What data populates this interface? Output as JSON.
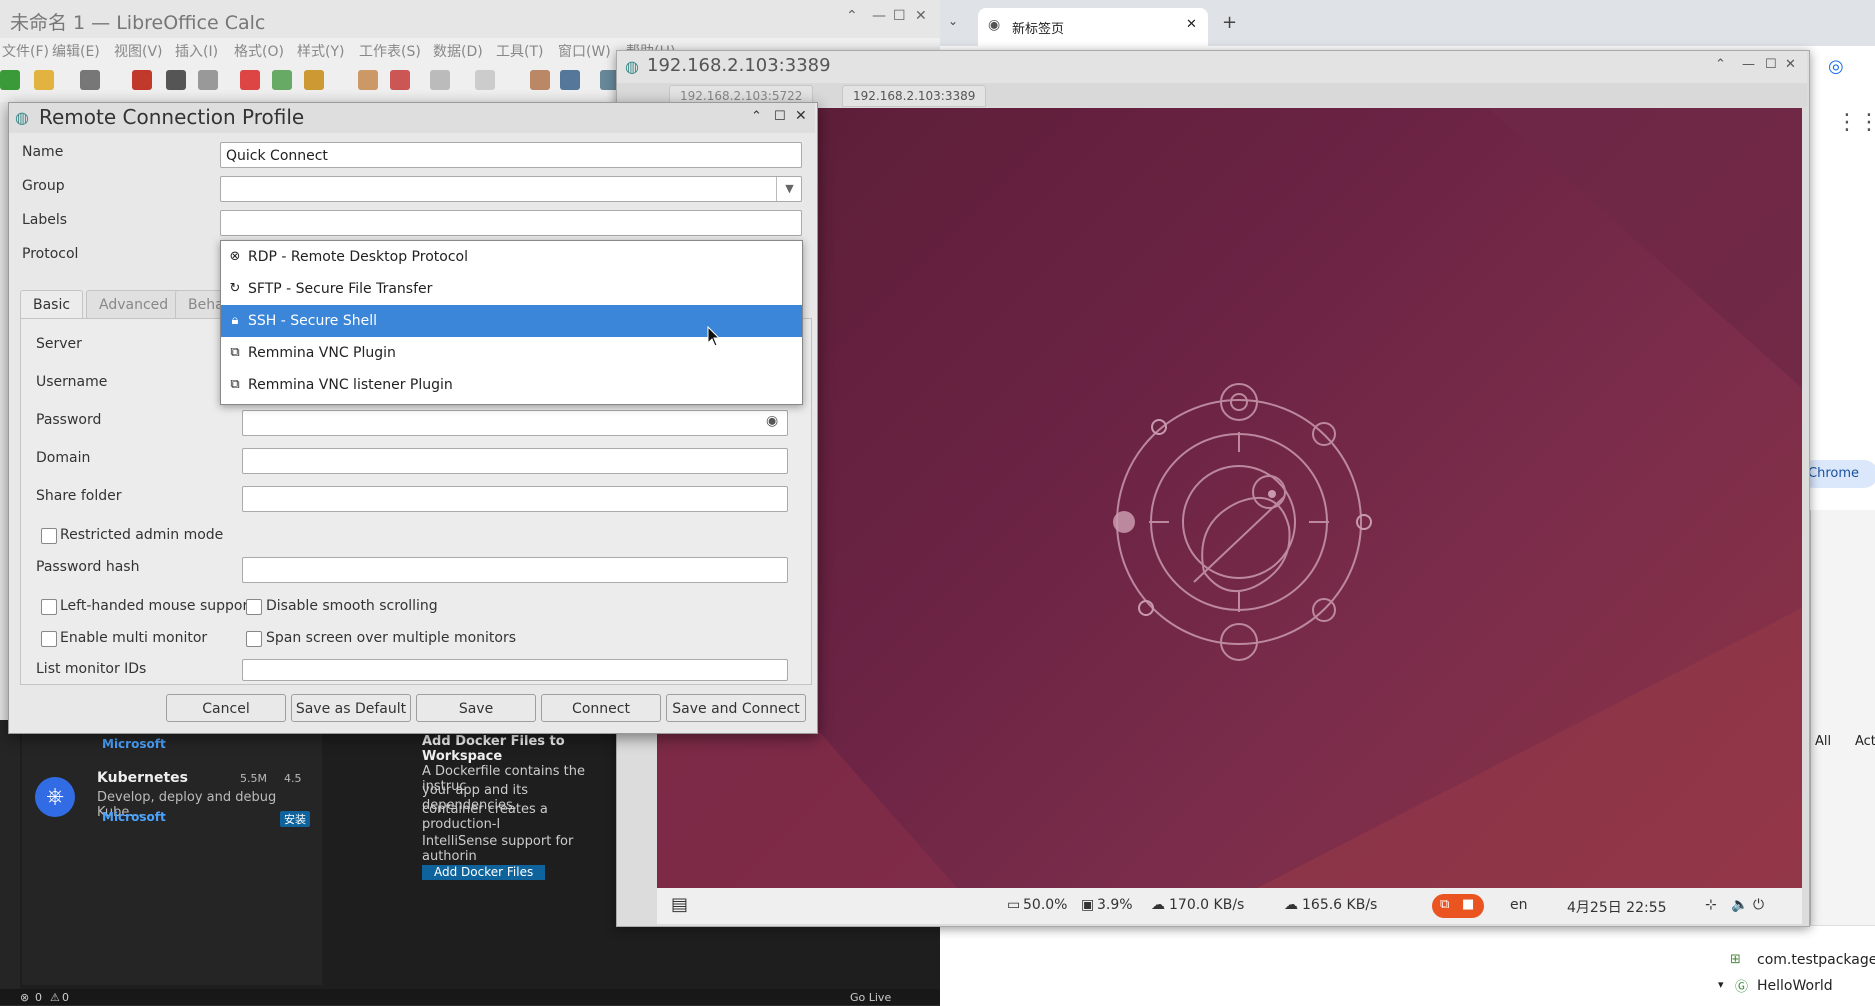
{
  "calc": {
    "title": "未命名 1 — LibreOffice Calc",
    "menu": [
      "文件(F)",
      "编辑(E)",
      "视图(V)",
      "插入(I)",
      "格式(O)",
      "样式(Y)",
      "工作表(S)",
      "数据(D)",
      "工具(T)",
      "窗口(W)",
      "帮助(H)"
    ]
  },
  "chrome": {
    "tab_title": "新标签页",
    "new_tab": "+",
    "chip": "Chrome"
  },
  "remmina": {
    "title": "192.168.2.103:3389",
    "tabs": [
      "192.168.2.103:5722",
      "192.168.2.103:3389"
    ]
  },
  "remote_desktop": {
    "cpu": "50.0%",
    "mem": "3.9%",
    "net_down": "170.0 KB/s",
    "net_up": "165.6 KB/s",
    "lang": "en",
    "datetime": "4月25日  22:55"
  },
  "dialog": {
    "title": "Remote Connection Profile",
    "fields": {
      "name_label": "Name",
      "name_value": "Quick Connect",
      "group_label": "Group",
      "labels_label": "Labels",
      "protocol_label": "Protocol"
    },
    "tabs": [
      "Basic",
      "Advanced",
      "Beha"
    ],
    "basic": {
      "server": "Server",
      "username": "Username",
      "password": "Password",
      "domain": "Domain",
      "share_folder": "Share folder",
      "restricted_admin": "Restricted admin mode",
      "password_hash": "Password hash",
      "left_handed": "Left-handed mouse support",
      "disable_smooth": "Disable smooth scrolling",
      "multi_monitor": "Enable multi monitor",
      "span_screen": "Span screen over multiple monitors",
      "monitor_ids": "List monitor IDs"
    },
    "protocol_options": [
      {
        "label": "RDP - Remote Desktop Protocol",
        "icon": "rdp-icon"
      },
      {
        "label": "SFTP - Secure File Transfer",
        "icon": "sftp-icon"
      },
      {
        "label": "SSH - Secure Shell",
        "icon": "ssh-icon",
        "selected": true
      },
      {
        "label": "Remmina VNC Plugin",
        "icon": "vnc-icon"
      },
      {
        "label": "Remmina VNC listener Plugin",
        "icon": "vnc-listener-icon"
      }
    ],
    "buttons": {
      "cancel": "Cancel",
      "save_default": "Save as Default",
      "save": "Save",
      "connect": "Connect",
      "save_connect": "Save and Connect"
    }
  },
  "vscode": {
    "ext_publisher": "Microsoft",
    "ext_name": "Kubernetes",
    "ext_downloads": "5.5M",
    "ext_rating": "4.5",
    "ext_desc": "Develop, deploy and debug Kube…",
    "ext_install": "安装",
    "detail_title": "Add Docker Files to Workspace",
    "detail_line1": "A Dockerfile contains the instruc",
    "detail_line2": "your app and its dependencies.",
    "detail_line3": "container creates a production-l",
    "detail_line4": "IntelliSense support for authorin",
    "detail_button": "Add Docker Files",
    "status_errors": "0",
    "status_warnings": "0",
    "go_live": "Go Live"
  },
  "ide": {
    "tree_pkg": "com.testpackage",
    "tree_class": "HelloWorld",
    "all": "All",
    "act": "Act"
  }
}
